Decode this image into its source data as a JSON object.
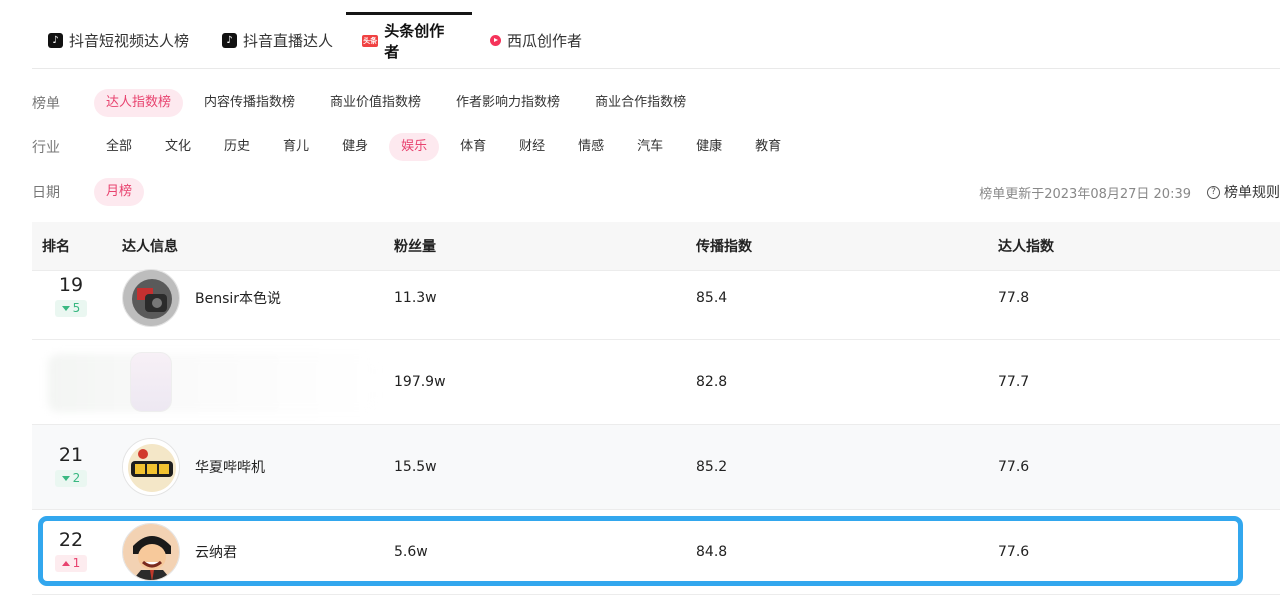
{
  "tabs": [
    {
      "label": "抖音短视频达人榜",
      "icon": "douyin-icon"
    },
    {
      "label": "抖音直播达人",
      "icon": "douyin-icon"
    },
    {
      "label": "头条创作者",
      "icon": "toutiao-icon",
      "icon_text": "头条"
    },
    {
      "label": "西瓜创作者",
      "icon": "xigua-icon"
    }
  ],
  "filters": {
    "list": {
      "label": "榜单",
      "options": [
        "达人指数榜",
        "内容传播指数榜",
        "商业价值指数榜",
        "作者影响力指数榜",
        "商业合作指数榜"
      ],
      "selected": "达人指数榜"
    },
    "industry": {
      "label": "行业",
      "options": [
        "全部",
        "文化",
        "历史",
        "育儿",
        "健身",
        "娱乐",
        "体育",
        "财经",
        "情感",
        "汽车",
        "健康",
        "教育"
      ],
      "selected": "娱乐"
    },
    "date": {
      "label": "日期",
      "options": [
        "月榜"
      ],
      "selected": "月榜"
    }
  },
  "update_text": "榜单更新于2023年08月27日 20:39",
  "rules_label": "榜单规则",
  "table": {
    "headers": {
      "rank": "排名",
      "info": "达人信息",
      "fans": "粉丝量",
      "spread": "传播指数",
      "index": "达人指数"
    },
    "rows": [
      {
        "rank": "19",
        "change": "5",
        "direction": "down",
        "name": "Bensir本色说",
        "fans": "11.3w",
        "spread": "85.4",
        "index": "77.8"
      },
      {
        "rank": "",
        "change": "",
        "direction": "",
        "name": "",
        "fans": "197.9w",
        "spread": "82.8",
        "index": "77.7"
      },
      {
        "rank": "21",
        "change": "2",
        "direction": "down",
        "name": "华夏哔哔机",
        "fans": "15.5w",
        "spread": "85.2",
        "index": "77.6"
      },
      {
        "rank": "22",
        "change": "1",
        "direction": "up",
        "name": "云纳君",
        "fans": "5.6w",
        "spread": "84.8",
        "index": "77.6"
      }
    ]
  },
  "colors": {
    "accent_pink": "#e8436f",
    "chip_bg": "#fde9ef",
    "down_green": "#39b881",
    "highlight_blue": "#32a7ee"
  }
}
